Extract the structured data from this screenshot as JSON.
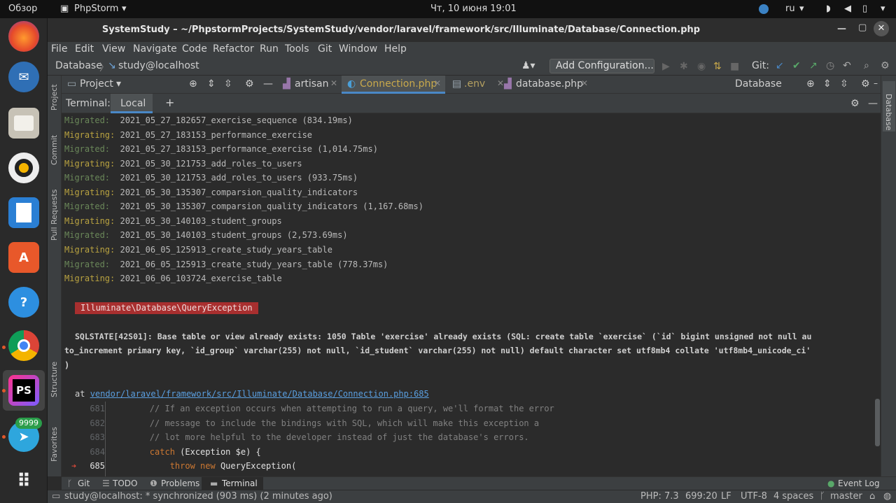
{
  "topbar": {
    "overview": "Обзор",
    "app_name": "PhpStorm",
    "datetime": "Чт, 10 июня  19:01",
    "lang": "ru"
  },
  "dock": {
    "telegram_badge": "9999"
  },
  "window": {
    "title": "SystemStudy – ~/PhpstormProjects/SystemStudy/vendor/laravel/framework/src/Illuminate/Database/Connection.php"
  },
  "menu": [
    "File",
    "Edit",
    "View",
    "Navigate",
    "Code",
    "Refactor",
    "Run",
    "Tools",
    "Git",
    "Window",
    "Help"
  ],
  "navbar": {
    "breadcrumb_root": "Database",
    "breadcrumb_child": "study@localhost",
    "add_configuration": "Add Configuration...",
    "git_label": "Git:"
  },
  "toolbar": {
    "project_label": "Project",
    "database_label": "Database",
    "tabs": [
      "artisan",
      "Connection.php",
      ".env",
      "database.php"
    ]
  },
  "left_stripe": {
    "project": "Project",
    "commit": "Commit",
    "pull_requests": "Pull Requests",
    "structure": "Structure",
    "favorites": "Favorites"
  },
  "right_stripe": {
    "database": "Database"
  },
  "terminal": {
    "header_label": "Terminal:",
    "tab_local": "Local",
    "plus": "+",
    "lines": [
      {
        "status": "Migrated:",
        "text": "2021_05_27_182657_exercise_sequence (834.19ms)"
      },
      {
        "status": "Migrating:",
        "text": "2021_05_27_183153_performance_exercise"
      },
      {
        "status": "Migrated:",
        "text": "2021_05_27_183153_performance_exercise (1,014.75ms)"
      },
      {
        "status": "Migrating:",
        "text": "2021_05_30_121753_add_roles_to_users"
      },
      {
        "status": "Migrated:",
        "text": "2021_05_30_121753_add_roles_to_users (933.75ms)"
      },
      {
        "status": "Migrating:",
        "text": "2021_05_30_135307_comparsion_quality_indicators"
      },
      {
        "status": "Migrated:",
        "text": "2021_05_30_135307_comparsion_quality_indicators (1,167.68ms)"
      },
      {
        "status": "Migrating:",
        "text": "2021_05_30_140103_student_groups"
      },
      {
        "status": "Migrated:",
        "text": "2021_05_30_140103_student_groups (2,573.69ms)"
      },
      {
        "status": "Migrating:",
        "text": "2021_06_05_125913_create_study_years_table"
      },
      {
        "status": "Migrated:",
        "text": "2021_06_05_125913_create_study_years_table (778.37ms)"
      },
      {
        "status": "Migrating:",
        "text": "2021_06_06_103724_exercise_table"
      }
    ],
    "exception_class": "Illuminate\\Database\\QueryException",
    "error_line1": "SQLSTATE[42S01]: Base table or view already exists: 1050 Table 'exercise' already exists (SQL: create table `exercise` (`id` bigint unsigned not null au",
    "error_line2": "to_increment primary key, `id_group` varchar(255) not null, `id_student` varchar(255) not null) default character set utf8mb4 collate 'utf8mb4_unicode_ci'",
    "error_line3": ")",
    "at_label": "at",
    "at_path": "vendor/laravel/framework/src/Illuminate/Database/Connection.php:685",
    "code": [
      {
        "num": "681",
        "text": "        // If an exception occurs when attempting to run a query, we'll format the error"
      },
      {
        "num": "682",
        "text": "        // message to include the bindings with SQL, which will make this exception a"
      },
      {
        "num": "683",
        "text": "        // lot more helpful to the developer instead of just the database's errors."
      },
      {
        "num": "684",
        "text_kw": "        catch",
        "text_rest": " (Exception $e) {"
      },
      {
        "num": "685",
        "text_kw": "            throw new",
        "text_rest": " QueryException("
      }
    ],
    "arrow": "➔"
  },
  "bottom_tabs": [
    "Git",
    "TODO",
    "Problems",
    "Terminal"
  ],
  "event_log": "Event Log",
  "status": {
    "message": "study@localhost: * synchronized (903 ms) (2 minutes ago)",
    "php": "PHP: 7.3",
    "position": "699:20",
    "line_sep": "LF",
    "encoding": "UTF-8",
    "indent": "4 spaces",
    "branch": "master"
  },
  "colors": {
    "migrated": "#6a8759",
    "migrating": "#b8a240",
    "exception_bg": "#a82f2f",
    "link": "#5a9fe0",
    "accent": "#4a88c7"
  }
}
